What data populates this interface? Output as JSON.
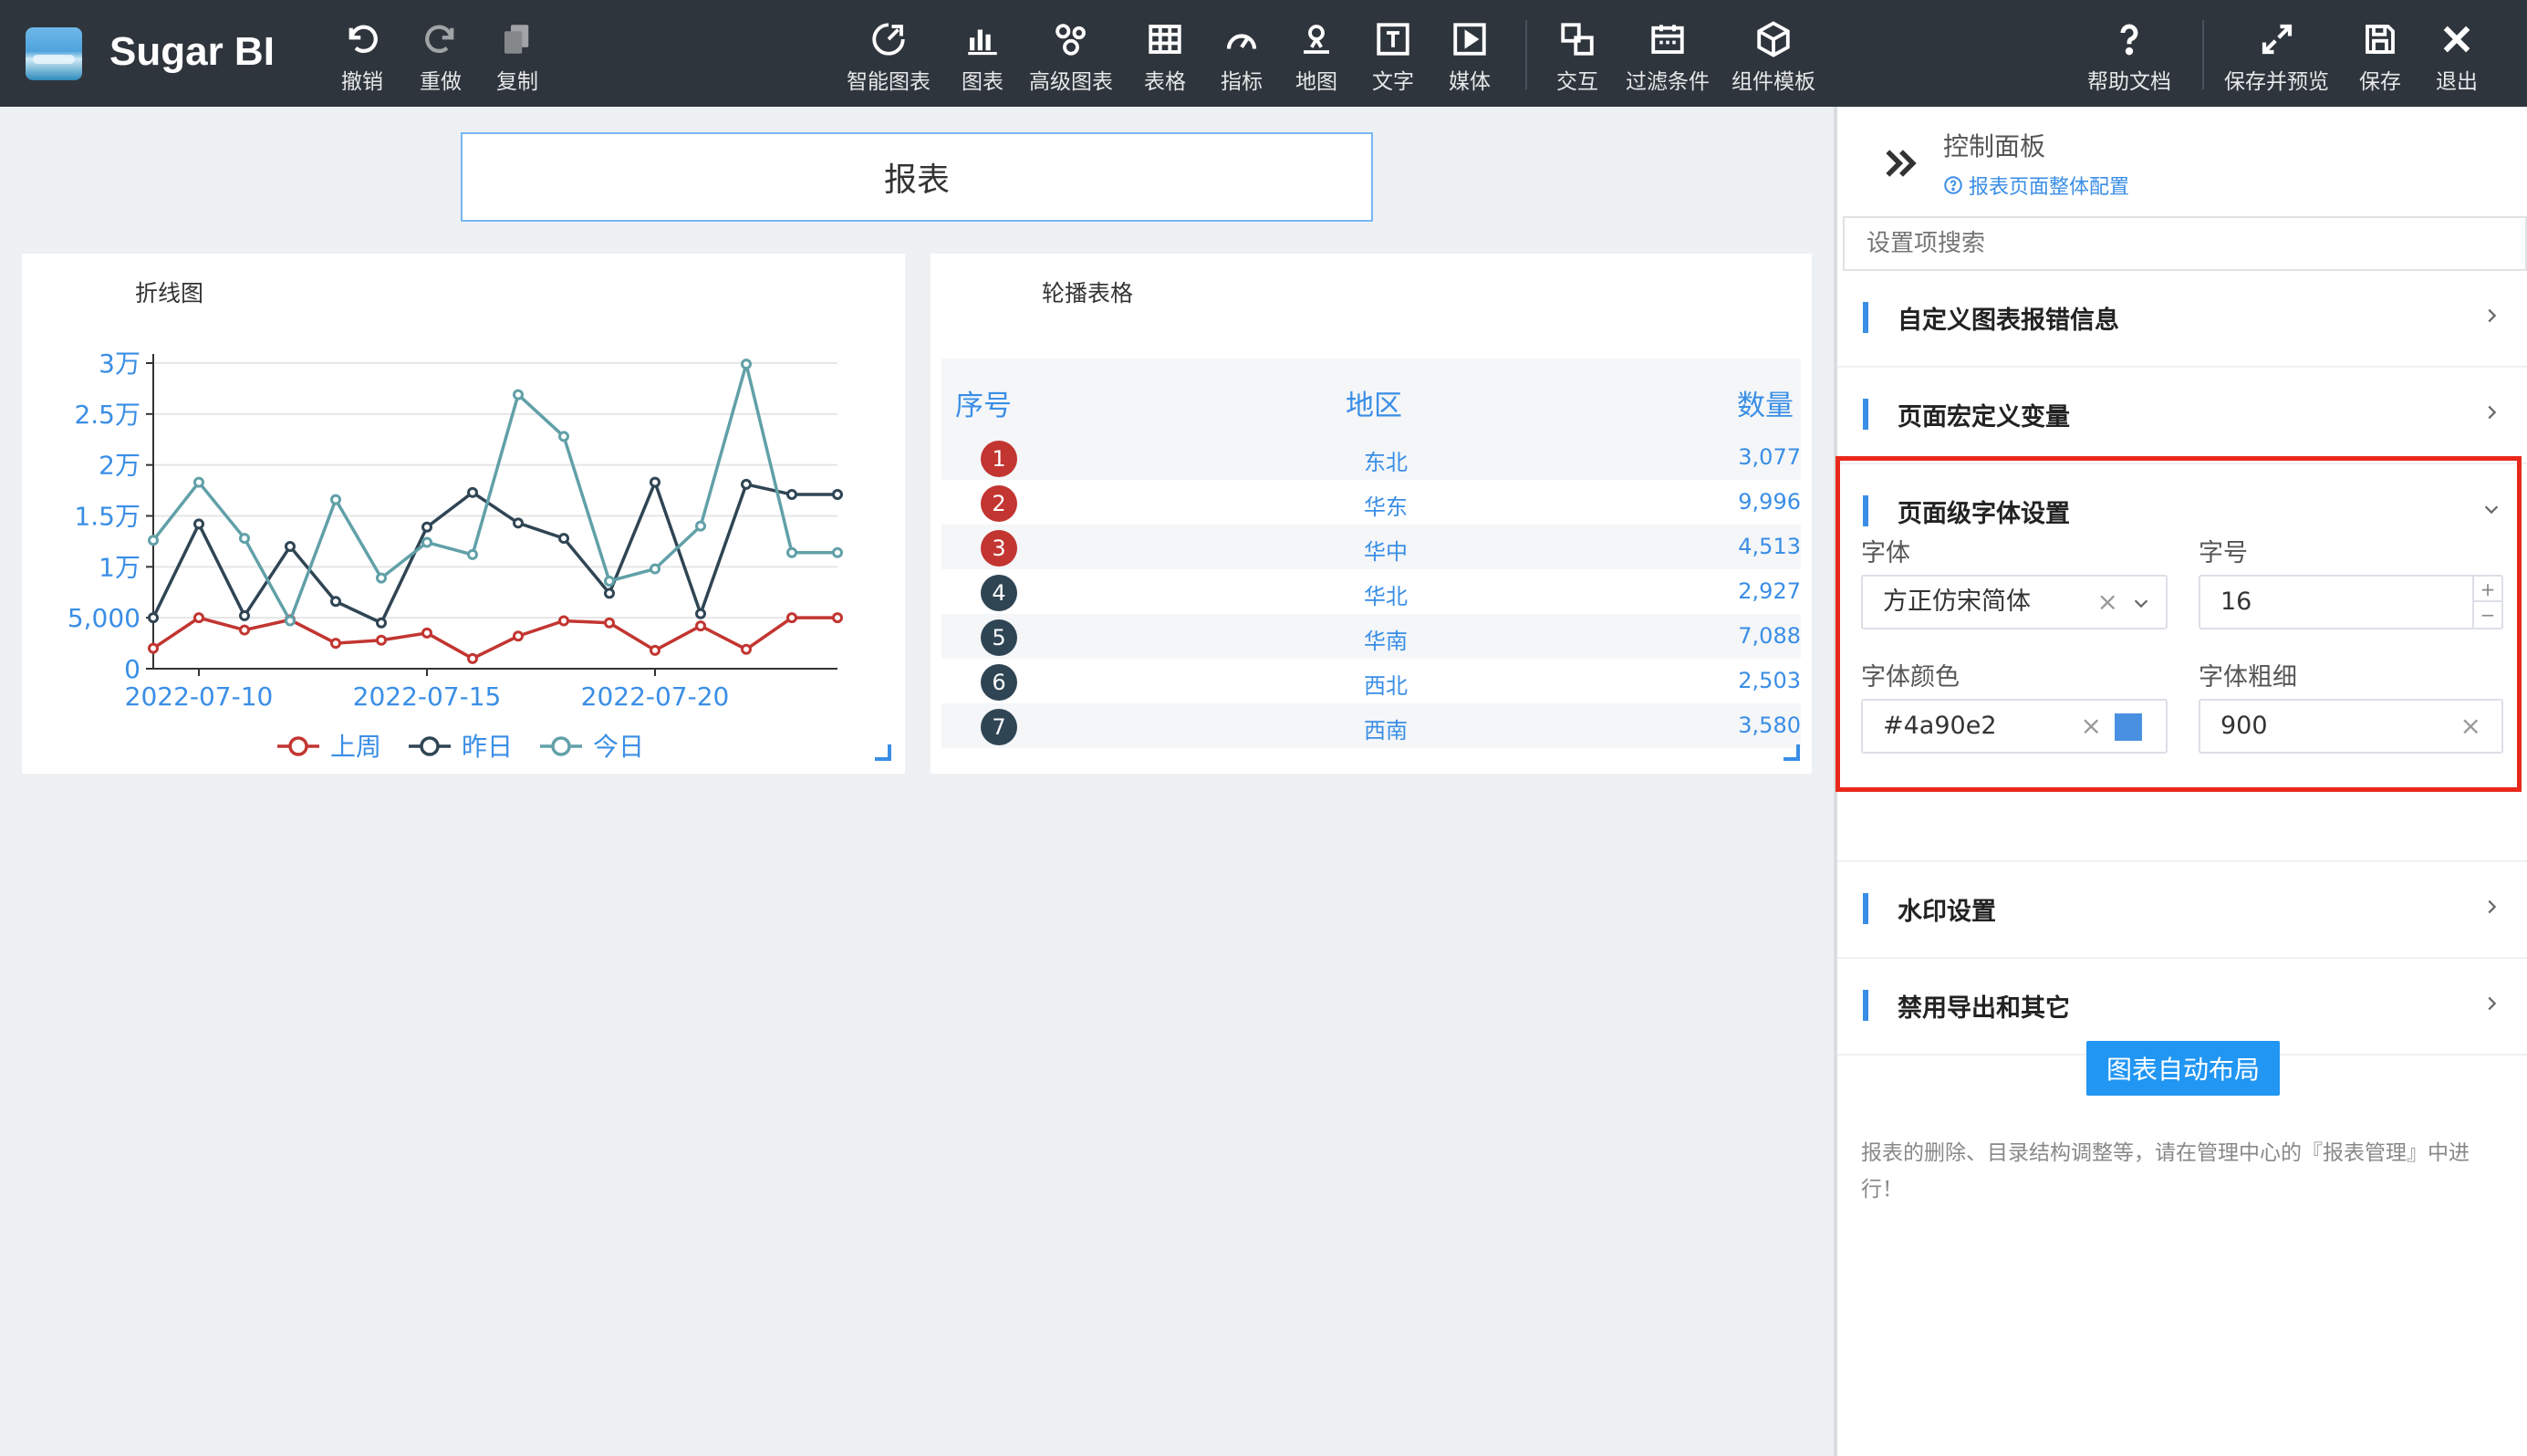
{
  "app": {
    "name": "Sugar BI"
  },
  "toolbar": {
    "left": [
      {
        "id": "undo",
        "label": "撤销",
        "icon": "undo-icon"
      },
      {
        "id": "redo",
        "label": "重做",
        "icon": "redo-icon"
      },
      {
        "id": "copy",
        "label": "复制",
        "icon": "copy-icon"
      }
    ],
    "center": [
      {
        "id": "smart-chart",
        "label": "智能图表",
        "icon": "smart-chart-icon"
      },
      {
        "id": "chart",
        "label": "图表",
        "icon": "bar-chart-icon"
      },
      {
        "id": "advanced-chart",
        "label": "高级图表",
        "icon": "advanced-chart-icon"
      },
      {
        "id": "table",
        "label": "表格",
        "icon": "table-icon"
      },
      {
        "id": "indicator",
        "label": "指标",
        "icon": "gauge-icon"
      },
      {
        "id": "map",
        "label": "地图",
        "icon": "map-pin-icon"
      },
      {
        "id": "text",
        "label": "文字",
        "icon": "text-icon"
      },
      {
        "id": "media",
        "label": "媒体",
        "icon": "media-play-icon"
      },
      {
        "id": "interaction",
        "label": "交互",
        "icon": "interaction-icon"
      },
      {
        "id": "filter",
        "label": "过滤条件",
        "icon": "filter-calendar-icon"
      },
      {
        "id": "component-template",
        "label": "组件模板",
        "icon": "cube-icon"
      }
    ],
    "right": [
      {
        "id": "help",
        "label": "帮助文档",
        "icon": "help-icon"
      },
      {
        "id": "save-preview",
        "label": "保存并预览",
        "icon": "expand-icon"
      },
      {
        "id": "save",
        "label": "保存",
        "icon": "save-icon"
      },
      {
        "id": "exit",
        "label": "退出",
        "icon": "close-icon"
      }
    ]
  },
  "report": {
    "title": "报表"
  },
  "line_card": {
    "title": "折线图"
  },
  "table_card": {
    "title": "轮播表格",
    "headers": {
      "index": "序号",
      "region": "地区",
      "qty": "数量"
    },
    "rows": [
      {
        "rank": "1",
        "region": "东北",
        "qty": "3,077"
      },
      {
        "rank": "2",
        "region": "华东",
        "qty": "9,996"
      },
      {
        "rank": "3",
        "region": "华中",
        "qty": "4,513"
      },
      {
        "rank": "4",
        "region": "华北",
        "qty": "2,927"
      },
      {
        "rank": "5",
        "region": "华南",
        "qty": "7,088"
      },
      {
        "rank": "6",
        "region": "西北",
        "qty": "2,503"
      },
      {
        "rank": "7",
        "region": "西南",
        "qty": "3,580"
      }
    ],
    "colors": {
      "top_rank": "#c23531",
      "other_rank": "#2f4554",
      "text": "#3a8ee6"
    }
  },
  "chart_data": {
    "type": "line",
    "title": "折线图",
    "x_labels": [
      "2022-07-10",
      "2022-07-15",
      "2022-07-20"
    ],
    "x": [
      "2022-07-09",
      "2022-07-10",
      "2022-07-11",
      "2022-07-12",
      "2022-07-13",
      "2022-07-14",
      "2022-07-15",
      "2022-07-16",
      "2022-07-17",
      "2022-07-18",
      "2022-07-19",
      "2022-07-20",
      "2022-07-21",
      "2022-07-22",
      "2022-07-23",
      "2022-07-24"
    ],
    "y_ticks": [
      "0",
      "5,000",
      "1万",
      "1.5万",
      "2万",
      "2.5万",
      "3万"
    ],
    "ylim": [
      0,
      30000
    ],
    "grid": true,
    "legend_position": "bottom",
    "series": [
      {
        "name": "上周",
        "color": "#c23531",
        "values": [
          2000,
          5000,
          3800,
          4800,
          2500,
          2800,
          3500,
          1000,
          3200,
          4700,
          4500,
          1800,
          4200,
          1900,
          5000,
          5000
        ]
      },
      {
        "name": "昨日",
        "color": "#2f4554",
        "values": [
          5000,
          14200,
          5200,
          12000,
          6600,
          4500,
          13900,
          17300,
          14300,
          12800,
          7400,
          18300,
          5400,
          18100,
          17100,
          17100
        ]
      },
      {
        "name": "今日",
        "color": "#61a0a8",
        "values": [
          12600,
          18300,
          12800,
          4700,
          16600,
          8900,
          12400,
          11200,
          26900,
          22800,
          8600,
          9800,
          14000,
          29900,
          11400,
          11400
        ]
      }
    ]
  },
  "panel": {
    "title": "控制面板",
    "subtitle": "报表页面整体配置",
    "search_placeholder": "设置项搜索",
    "sections": [
      {
        "id": "custom-error",
        "title": "自定义图表报错信息"
      },
      {
        "id": "page-macro",
        "title": "页面宏定义变量"
      },
      {
        "id": "font-settings",
        "title": "页面级字体设置"
      },
      {
        "id": "watermark",
        "title": "水印设置"
      },
      {
        "id": "disable-export",
        "title": "禁用导出和其它"
      }
    ],
    "font": {
      "family_label": "字体",
      "family_value": "方正仿宋简体",
      "size_label": "字号",
      "size_value": "16",
      "color_label": "字体颜色",
      "color_value": "#4a90e2",
      "weight_label": "字体粗细",
      "weight_value": "900",
      "plus": "+",
      "minus": "−",
      "clear": "×"
    },
    "auto_layout_label": "图表自动布局",
    "note": "报表的删除、目录结构调整等，请在管理中心的『报表管理』中进行！",
    "highlight_color": "#e8281a"
  }
}
